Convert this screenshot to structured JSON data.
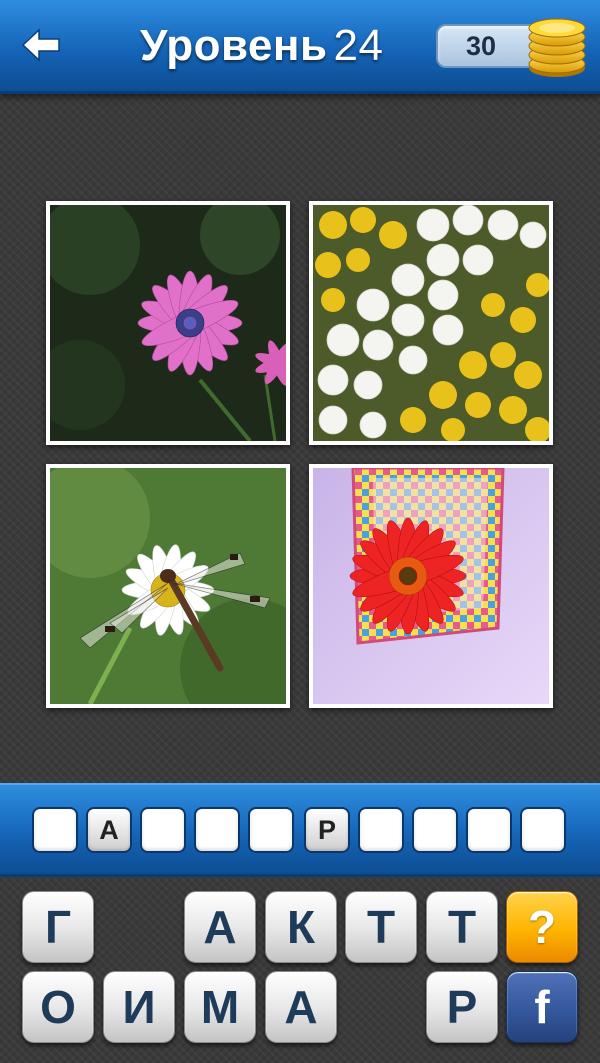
{
  "header": {
    "title_word": "Уровень",
    "level": "24",
    "coins": "30",
    "back_icon": "back-arrow-icon",
    "coins_icon": "gold-coins-stack-icon",
    "colors": {
      "bar_top": "#2f8de0",
      "bar_bottom": "#0d4d92"
    }
  },
  "photos": [
    {
      "name": "pink-daisy-photo"
    },
    {
      "name": "white-yellow-chrysanthemums-photo"
    },
    {
      "name": "dragonfly-on-daisy-photo"
    },
    {
      "name": "red-gerbera-basket-photo"
    }
  ],
  "answer": {
    "slots": [
      "",
      "А",
      "",
      "",
      "",
      "Р",
      "",
      "",
      "",
      ""
    ]
  },
  "keyboard": {
    "row1": [
      "Г",
      "",
      "А",
      "К",
      "Т",
      "Т"
    ],
    "row2": [
      "О",
      "И",
      "М",
      "А",
      "",
      "Р"
    ],
    "hint_label": "?",
    "facebook_label": "f",
    "colors": {
      "hint": "#ffb400",
      "facebook": "#35579c"
    }
  }
}
